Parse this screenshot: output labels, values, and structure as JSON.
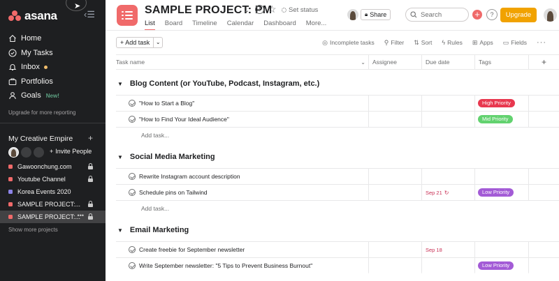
{
  "app": {
    "logo_text": "asana"
  },
  "sidebar": {
    "nav": [
      {
        "label": "Home"
      },
      {
        "label": "My Tasks"
      },
      {
        "label": "Inbox"
      },
      {
        "label": "Portfolios"
      },
      {
        "label": "Goals",
        "badge": "New!"
      }
    ],
    "upgrade_reporting": "Upgrade for more reporting",
    "team_title": "My Creative Empire",
    "invite_label": "Invite People",
    "projects": [
      {
        "label": "Gawoonchung.com",
        "color": "#f06a6a"
      },
      {
        "label": "Youtube Channel",
        "color": "#f06a6a"
      },
      {
        "label": "Korea Events 2020",
        "color": "#8d84e8"
      },
      {
        "label": "SAMPLE PROJECT:...",
        "color": "#f06a6a"
      },
      {
        "label": "SAMPLE PROJECT:...",
        "color": "#f06a6a",
        "active": true
      }
    ],
    "show_more": "Show more projects"
  },
  "header": {
    "title": "SAMPLE PROJECT: PM",
    "set_status": "Set status",
    "tabs": [
      "List",
      "Board",
      "Timeline",
      "Calendar",
      "Dashboard",
      "More..."
    ],
    "active_tab": "List",
    "share_label": "Share",
    "search_placeholder": "Search",
    "upgrade_label": "Upgrade"
  },
  "toolbar": {
    "add_task": "+ Add task",
    "items": [
      "Incomplete tasks",
      "Filter",
      "Sort",
      "Rules",
      "Apps",
      "Fields"
    ]
  },
  "columns": {
    "name": "Task name",
    "assignee": "Assignee",
    "due": "Due date",
    "tags": "Tags"
  },
  "sections": [
    {
      "title": "Blog Content (or YouTube, Podcast, Instagram, etc.)",
      "tasks": [
        {
          "name": "\"How to Start a Blog\"",
          "due": "",
          "tag": "High Priority",
          "tag_color": "#e8384f"
        },
        {
          "name": "\"How to Find Your Ideal Audience\"",
          "due": "",
          "tag": "Mid Priority",
          "tag_color": "#62d26f"
        }
      ],
      "add_task": "Add task..."
    },
    {
      "title": "Social Media Marketing",
      "tasks": [
        {
          "name": "Rewrite Instagram account description",
          "due": "",
          "tag": "",
          "tag_color": ""
        },
        {
          "name": "Schedule pins on Tailwind",
          "due": "Sep 21",
          "recurring": true,
          "tag": "Low Priority",
          "tag_color": "#a35bd6"
        }
      ],
      "add_task": "Add task..."
    },
    {
      "title": "Email Marketing",
      "tasks": [
        {
          "name": "Create freebie for September newsletter",
          "due": "Sep 18",
          "tag": "",
          "tag_color": ""
        },
        {
          "name": "Write September newsletter: \"5 Tips to Prevent Business Burnout\"",
          "due": "",
          "tag": "Low Priority",
          "tag_color": "#a35bd6"
        }
      ]
    }
  ]
}
